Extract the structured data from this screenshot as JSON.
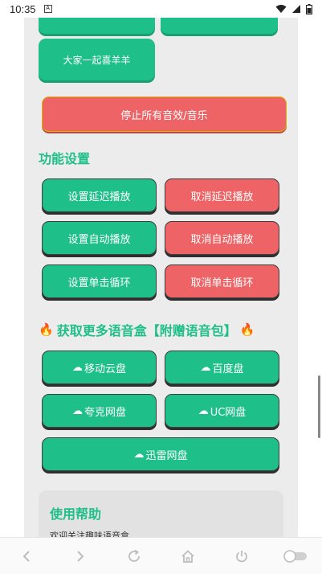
{
  "status": {
    "time": "10:35",
    "notification_glyph": "A"
  },
  "top_buttons": {
    "partial_left": "",
    "partial_right": "",
    "sheep_label": "大家一起喜羊羊"
  },
  "stop_all": {
    "label": "停止所有音效/音乐"
  },
  "function_settings": {
    "title": "功能设置",
    "rows": [
      {
        "set": "设置延迟播放",
        "cancel": "取消延迟播放"
      },
      {
        "set": "设置自动播放",
        "cancel": "取消自动播放"
      },
      {
        "set": "设置单击循环",
        "cancel": "取消单击循环"
      }
    ]
  },
  "more_boxes": {
    "title": "获取更多语音盒【附赠语音包】",
    "fire_icon": "fire-icon",
    "links": [
      "移动云盘",
      "百度盘",
      "夸克网盘",
      "UC网盘",
      "迅雷网盘"
    ]
  },
  "help": {
    "title": "使用帮助",
    "text": "欢迎关注趣味语音盒"
  },
  "colors": {
    "accent": "#1fbf8a",
    "danger": "#ee6466",
    "panel": "#ececec"
  }
}
